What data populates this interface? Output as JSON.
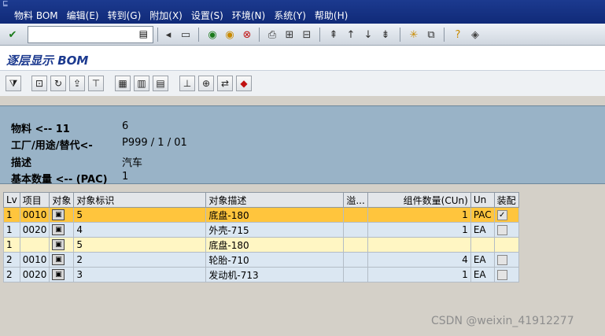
{
  "menu": {
    "corner": "⊑",
    "items": [
      "物料 BOM",
      "编辑(E)",
      "转到(G)",
      "附加(X)",
      "设置(S)",
      "环境(N)",
      "系统(Y)",
      "帮助(H)"
    ]
  },
  "toolbar": {
    "command_value": "",
    "icons": [
      "ok-icon",
      "dropdown-icon",
      "back-nav-icon",
      "save-icon",
      "back-icon",
      "exit-icon",
      "cancel-icon",
      "print-icon",
      "find-icon",
      "find-next-icon",
      "first-page-icon",
      "prev-page-icon",
      "next-page-icon",
      "last-page-icon",
      "new-session-icon",
      "shortcut-icon",
      "help-icon",
      "customize-icon"
    ]
  },
  "page": {
    "title": "逐层显示 BOM"
  },
  "header": {
    "material_label": "物料 <-- 11",
    "material_value": "6",
    "plant_label": "工厂/用途/替代<-",
    "plant_value": "P999 / 1 / 01",
    "desc_label": "描述",
    "desc_value": "汽车",
    "qty_label": "基本数量 <-- (PAC)",
    "qty_value": "1"
  },
  "grid": {
    "columns": [
      "Lv",
      "项目",
      "对象",
      "对象标识",
      "对象描述",
      "溢...",
      "组件数量(CUn)",
      "Un",
      "装配"
    ],
    "rows": [
      {
        "lv": "1",
        "item": "0010",
        "objid": "5",
        "desc": "底盘-180",
        "ovf": "",
        "qty": "1",
        "un": "PAC",
        "asm": "✓"
      },
      {
        "lv": "1",
        "item": "0020",
        "objid": "4",
        "desc": "外壳-715",
        "ovf": "",
        "qty": "1",
        "un": "EA",
        "asm": ""
      },
      {
        "lv": "1",
        "item": "",
        "objid": "5",
        "desc": "底盘-180",
        "ovf": "",
        "qty": "",
        "un": "",
        "asm": ""
      },
      {
        "lv": "2",
        "item": "0010",
        "objid": "2",
        "desc": "轮胎-710",
        "ovf": "",
        "qty": "4",
        "un": "EA",
        "asm": ""
      },
      {
        "lv": "2",
        "item": "0020",
        "objid": "3",
        "desc": "发动机-713",
        "ovf": "",
        "qty": "1",
        "un": "EA",
        "asm": ""
      }
    ]
  },
  "watermark": "CSDN @weixin_41912277"
}
